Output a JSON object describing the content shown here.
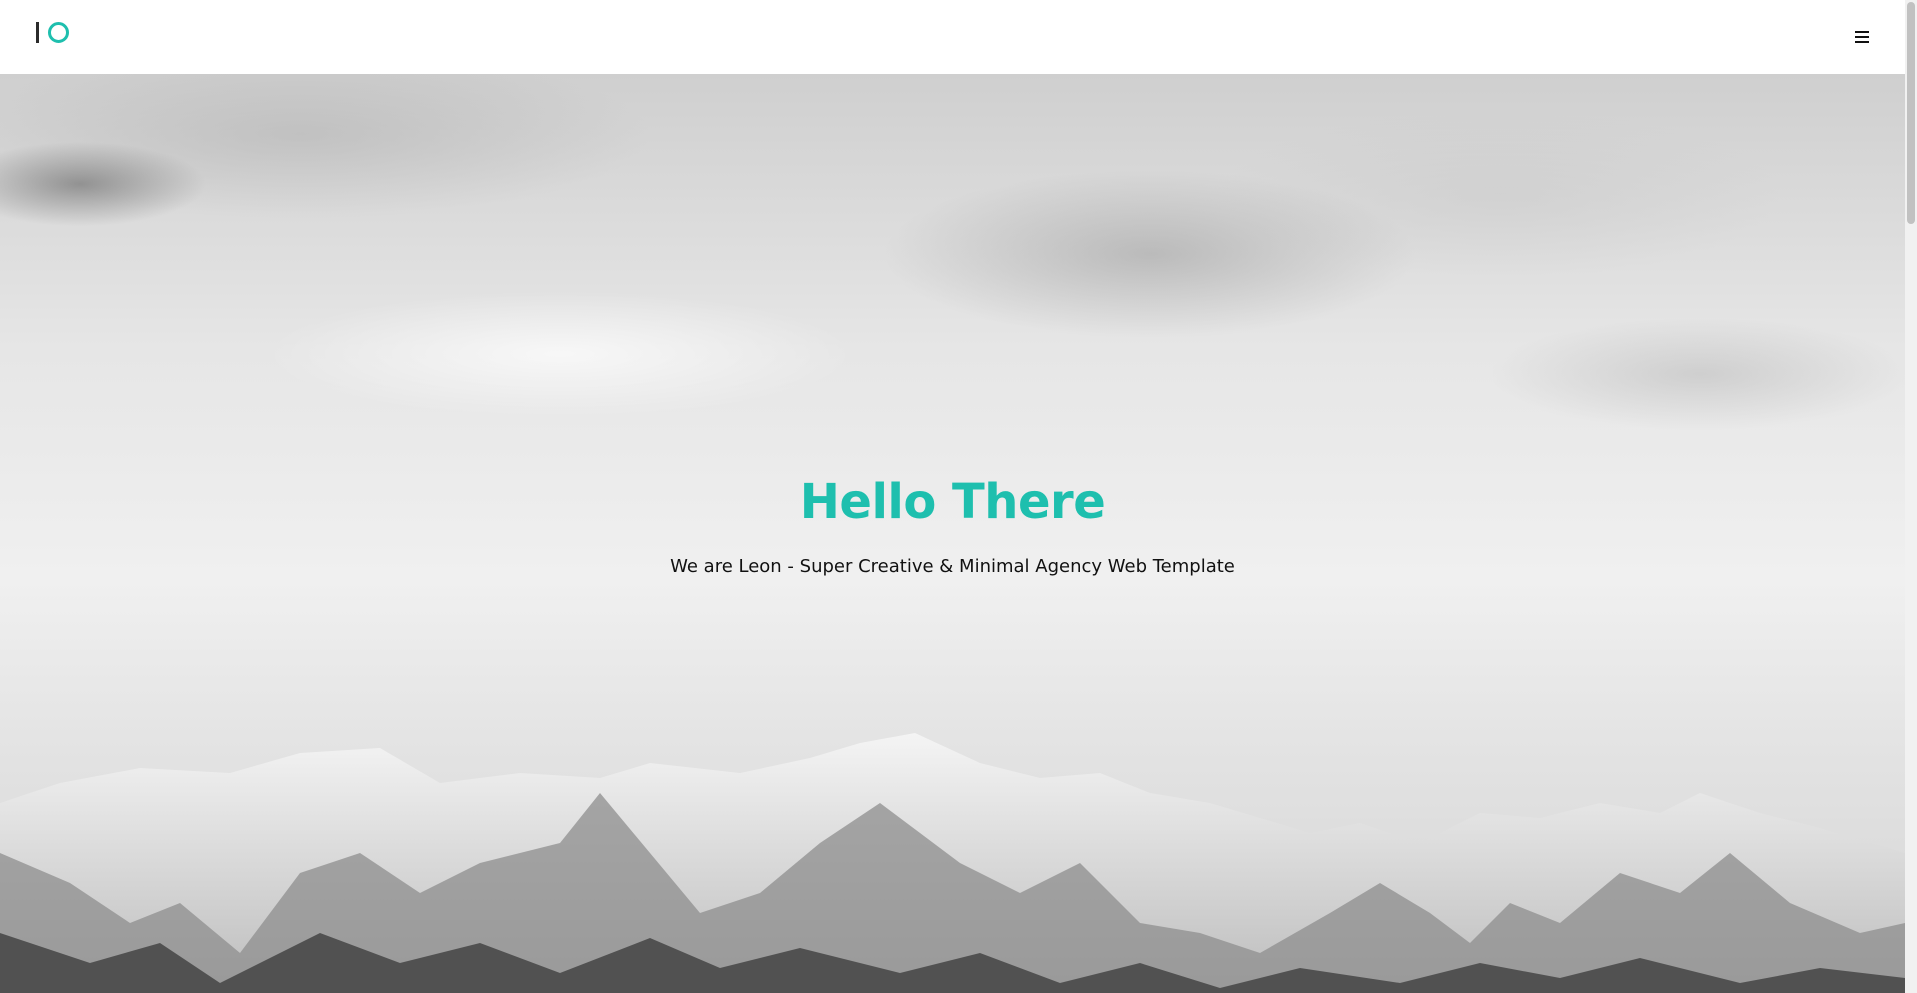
{
  "header": {
    "logo": {
      "icon": "io-logo-icon"
    },
    "menu": {
      "icon": "hamburger-menu-icon"
    }
  },
  "hero": {
    "title": "Hello There",
    "subtitle": "We are Leon - Super Creative & Minimal Agency Web Template"
  },
  "colors": {
    "accent": "#1ebfae",
    "header_bg": "#ffffff",
    "text": "#111111"
  }
}
